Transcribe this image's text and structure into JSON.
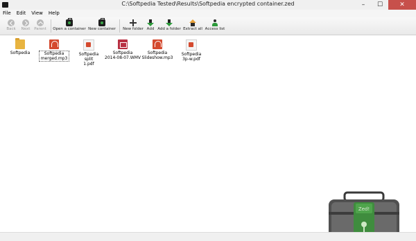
{
  "window": {
    "title": "C:\\Softpedia Tested\\Results\\Softpedia encrypted container.zed",
    "minimize": "–",
    "maximize": "☐",
    "close": "✕"
  },
  "menu": [
    "File",
    "Edit",
    "View",
    "Help"
  ],
  "toolbar": {
    "back": "Back",
    "next": "Next",
    "parent": "Parent",
    "open_container": "Open a container",
    "new_container": "New container",
    "new_folder": "New folder",
    "add": "Add",
    "add_folder": "Add a folder",
    "extract_all": "Extract all",
    "access_list": "Access list"
  },
  "files": [
    {
      "name": "Softpedia",
      "type": "folder-icon"
    },
    {
      "name": "Softpedia\nmerged.mp3",
      "type": "audio-icon"
    },
    {
      "name": "Softpedia\nsplit\n1.pdf",
      "type": "pdf-icon"
    },
    {
      "name": "Softpedia\n2014-08-07.WMV",
      "type": "video-icon"
    },
    {
      "name": "Softpedia\nSlideshow.mp3",
      "type": "audio-icon"
    },
    {
      "name": "Softpedia\n3p-w.pdf",
      "type": "pdf-icon"
    }
  ],
  "logo": {
    "text": "Zed!"
  },
  "colors": {
    "accent": "#c7504b",
    "green": "#2c9a3a"
  }
}
